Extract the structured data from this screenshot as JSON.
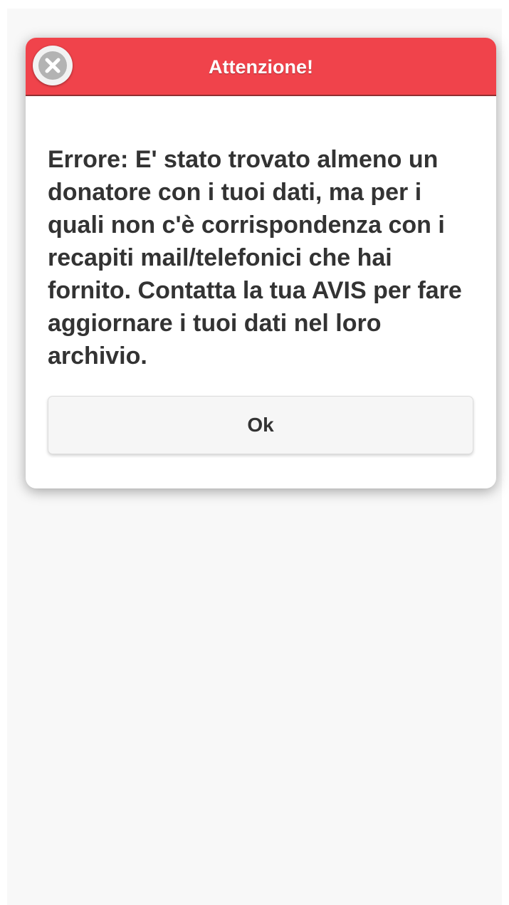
{
  "dialog": {
    "title": "Attenzione!",
    "close_icon": "close-circle-icon",
    "message": "Errore: E' stato trovato almeno un donatore con i tuoi dati, ma per i quali non c'è corrispondenza con i recapiti mail/telefonici che hai fornito. Contatta la tua AVIS per fare aggiornare i tuoi dati nel loro archivio.",
    "ok_label": "Ok"
  },
  "colors": {
    "header_background": "#f0434b",
    "header_text": "#ffffff",
    "body_text": "#333333",
    "page_background": "#f8f8f8",
    "button_background": "#f6f6f6"
  }
}
